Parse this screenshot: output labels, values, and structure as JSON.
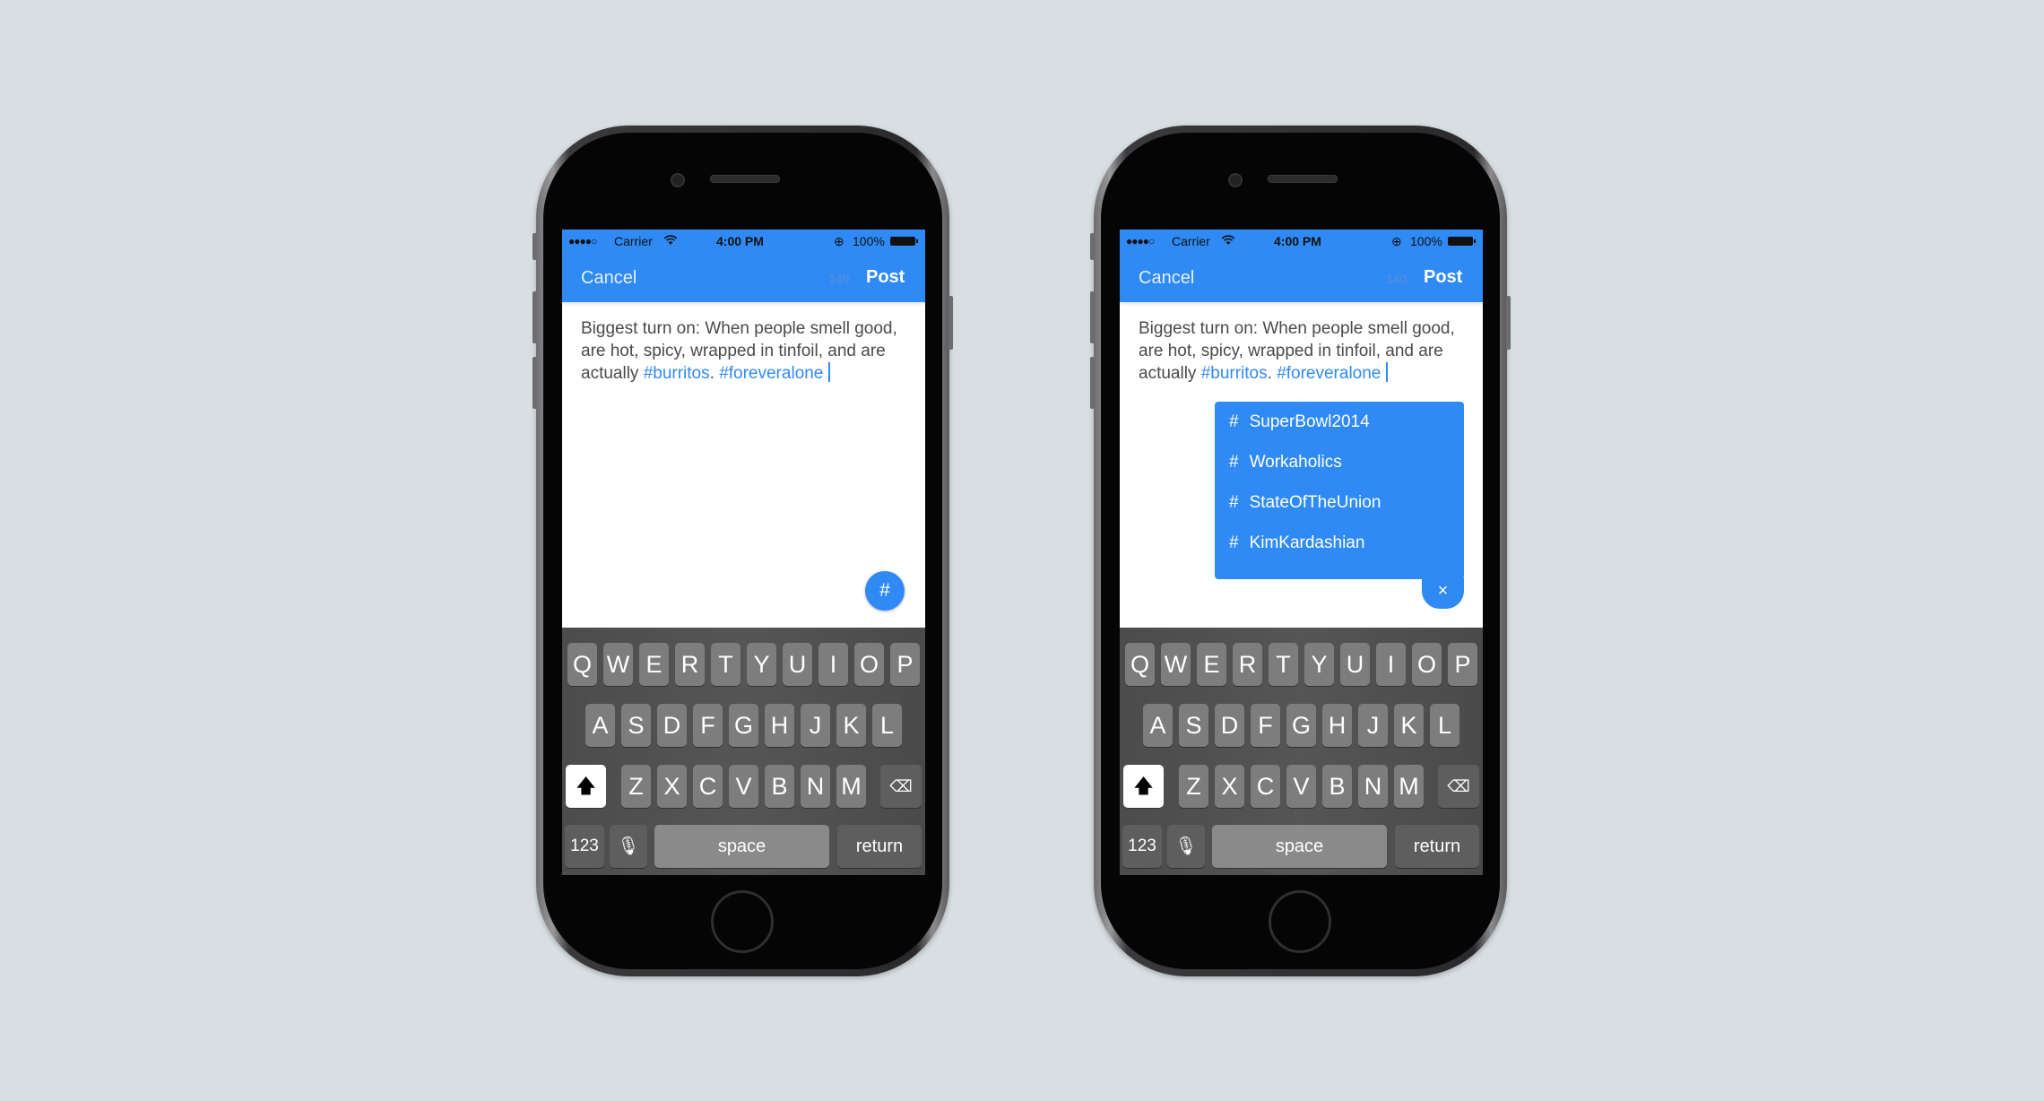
{
  "colors": {
    "accent": "#2f8af5",
    "background": "#d8dfe2"
  },
  "phones": [
    {
      "status": {
        "signal": "●●●●○",
        "carrier": "Carrier",
        "wifi": "wifi-icon",
        "time": "4:00 PM",
        "lock": "⊕",
        "battery": "100%"
      },
      "nav": {
        "cancel": "Cancel",
        "count": "140",
        "post": "Post"
      },
      "compose": {
        "text": "Biggest turn on: When people smell good, are hot, spicy, wrapped in tinfoil, and are actually ",
        "tag1": "#burritos",
        "sep": ". ",
        "tag2": "#foreveralone"
      },
      "hashtag_button": "#"
    },
    {
      "status": {
        "signal": "●●●●○",
        "carrier": "Carrier",
        "wifi": "wifi-icon",
        "time": "4:00 PM",
        "lock": "⊕",
        "battery": "100%"
      },
      "nav": {
        "cancel": "Cancel",
        "count": "140",
        "post": "Post"
      },
      "compose": {
        "text": "Biggest turn on: When people smell good, are hot, spicy, wrapped in tinfoil, and are actually ",
        "tag1": "#burritos",
        "sep": ". ",
        "tag2": "#foreveralone"
      },
      "suggestions": {
        "items": [
          {
            "hash": "#",
            "label": "SuperBowl2014"
          },
          {
            "hash": "#",
            "label": "Workaholics"
          },
          {
            "hash": "#",
            "label": "StateOfTheUnion"
          },
          {
            "hash": "#",
            "label": "KimKardashian"
          }
        ],
        "close": "×"
      }
    }
  ],
  "keyboard": {
    "rows": [
      [
        "Q",
        "W",
        "E",
        "R",
        "T",
        "Y",
        "U",
        "I",
        "O",
        "P"
      ],
      [
        "A",
        "S",
        "D",
        "F",
        "G",
        "H",
        "J",
        "K",
        "L"
      ],
      [
        "Z",
        "X",
        "C",
        "V",
        "B",
        "N",
        "M"
      ]
    ],
    "shift": "🡅",
    "backspace": "⌫",
    "numbers": "123",
    "mic": "🎙",
    "space": "space",
    "return": "return"
  }
}
